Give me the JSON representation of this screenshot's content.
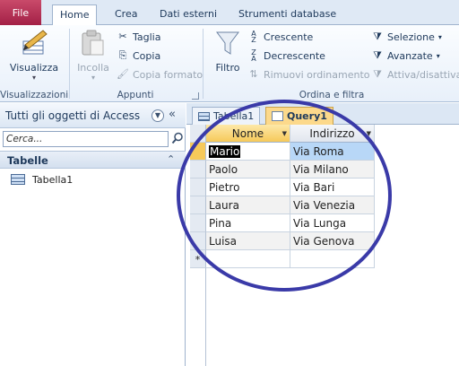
{
  "tabs": {
    "file": "File",
    "home": "Home",
    "create": "Crea",
    "external": "Dati esterni",
    "dbtools": "Strumenti database"
  },
  "ribbon": {
    "views": {
      "label": "Visualizzazioni",
      "view": "Visualizza"
    },
    "clipboard": {
      "label": "Appunti",
      "paste": "Incolla",
      "cut": "Taglia",
      "copy": "Copia",
      "format": "Copia formato"
    },
    "sort": {
      "label": "Ordina e filtra",
      "filter": "Filtro",
      "asc": "Crescente",
      "desc": "Decrescente",
      "remove": "Rimuovi ordinamento",
      "selection": "Selezione",
      "advanced": "Avanzate",
      "toggle": "Attiva/disattiva"
    }
  },
  "nav": {
    "title": "Tutti gli oggetti di Access",
    "search_placeholder": "Cerca...",
    "category": "Tabelle",
    "items": [
      {
        "label": "Tabella1"
      }
    ]
  },
  "doc_tabs": [
    {
      "label": "Tabella1"
    },
    {
      "label": "Query1"
    }
  ],
  "columns": [
    "Nome",
    "Indirizzo"
  ],
  "rows": [
    {
      "nome": "Mario",
      "indirizzo": "Via Roma"
    },
    {
      "nome": "Paolo",
      "indirizzo": "Via Milano"
    },
    {
      "nome": "Pietro",
      "indirizzo": "Via Bari"
    },
    {
      "nome": "Laura",
      "indirizzo": "Via Venezia"
    },
    {
      "nome": "Pina",
      "indirizzo": "Via Lunga"
    },
    {
      "nome": "Luisa",
      "indirizzo": "Via Genova"
    }
  ],
  "new_row_marker": "*",
  "colors": {
    "annotation_circle": "#3a3aa8",
    "file_tab": "#b22d52",
    "active_tab": "#fcd98b"
  }
}
